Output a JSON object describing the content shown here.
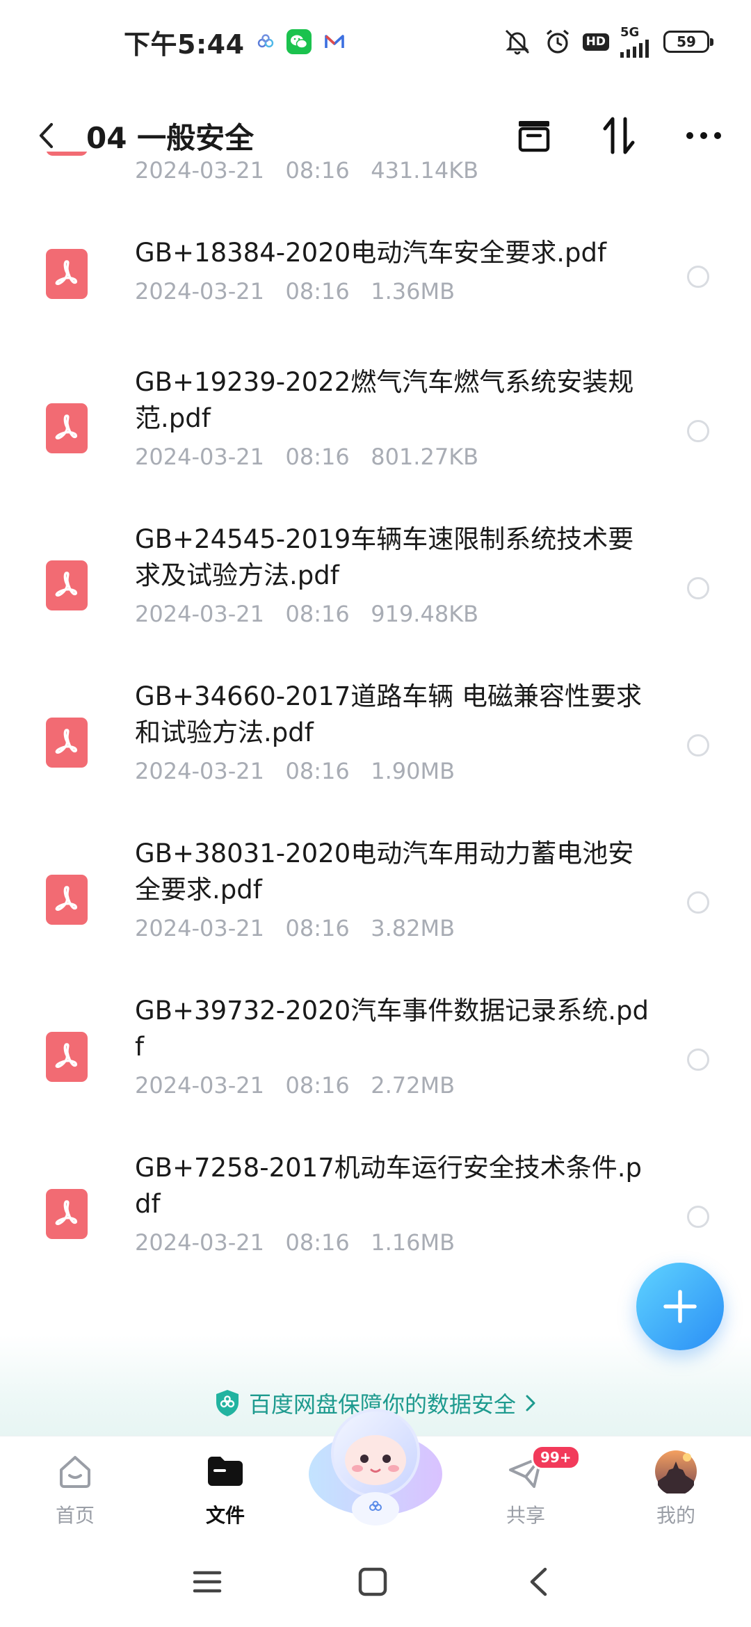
{
  "status_bar": {
    "time": "下午5:44",
    "hd_label": "HD",
    "network_label": "5G",
    "battery_level": "59"
  },
  "header": {
    "title": "04 一般安全",
    "icons": [
      "back-icon",
      "archive-box-icon",
      "sort-icon",
      "more-icon"
    ]
  },
  "partial_row": {
    "date": "2024-03-21",
    "time": "08:16",
    "size": "431.14KB"
  },
  "files": [
    {
      "name": "GB+18384-2020电动汽车安全要求.pdf",
      "date": "2024-03-21",
      "time": "08:16",
      "size": "1.36MB"
    },
    {
      "name": "GB+19239-2022燃气汽车燃气系统安装规范.pdf",
      "date": "2024-03-21",
      "time": "08:16",
      "size": "801.27KB"
    },
    {
      "name": "GB+24545-2019车辆车速限制系统技术要求及试验方法.pdf",
      "date": "2024-03-21",
      "time": "08:16",
      "size": "919.48KB"
    },
    {
      "name": "GB+34660-2017道路车辆 电磁兼容性要求和试验方法.pdf",
      "date": "2024-03-21",
      "time": "08:16",
      "size": "1.90MB"
    },
    {
      "name": "GB+38031-2020电动汽车用动力蓄电池安全要求.pdf",
      "date": "2024-03-21",
      "time": "08:16",
      "size": "3.82MB"
    },
    {
      "name": "GB+39732-2020汽车事件数据记录系统.pdf",
      "date": "2024-03-21",
      "time": "08:16",
      "size": "2.72MB"
    },
    {
      "name": "GB+7258-2017机动车运行安全技术条件.pdf",
      "date": "2024-03-21",
      "time": "08:16",
      "size": "1.16MB"
    }
  ],
  "security_banner": {
    "text": "百度网盘保障你的数据安全"
  },
  "tabs": [
    {
      "label": "首页",
      "icon": "home-icon",
      "active": false
    },
    {
      "label": "文件",
      "icon": "folder-icon",
      "active": true
    },
    {
      "label": "共享",
      "icon": "share-icon",
      "active": false,
      "badge": "99+"
    },
    {
      "label": "我的",
      "icon": "avatar-icon",
      "active": false
    }
  ],
  "colors": {
    "accent": "#2a8ef5",
    "pdf_red": "#f26b73",
    "security_green": "#1d9a8e",
    "badge_red": "#f23a5a"
  }
}
